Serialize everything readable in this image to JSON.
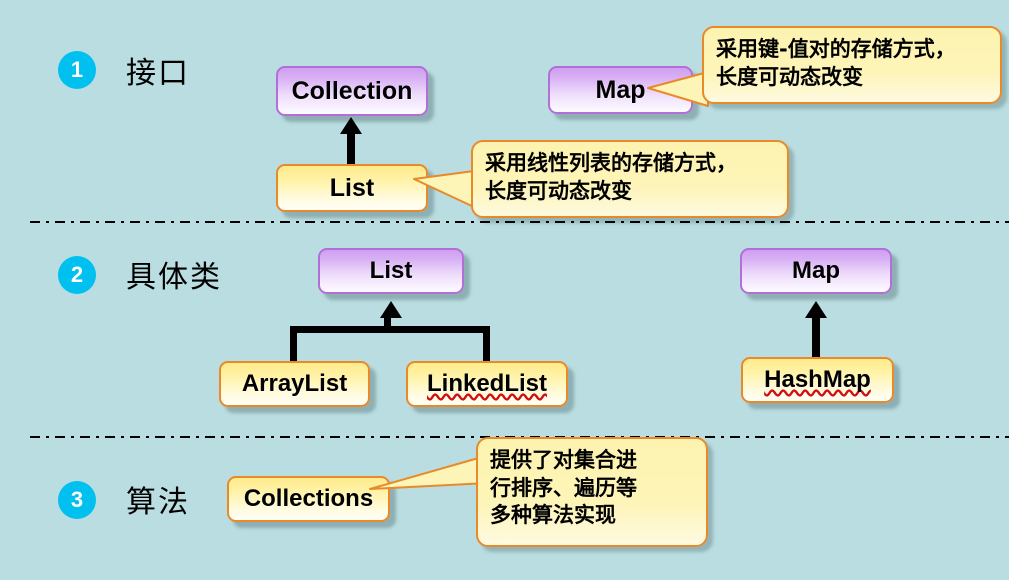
{
  "diagram": {
    "title_note": "Java collection framework hierarchy diagram",
    "background_color": "#b9dde0",
    "accent_badge_color": "#00c0f0",
    "interface_box_color": "#cf9ff0",
    "class_box_color": "#ffeb8d",
    "callout_border_color": "#e8892a"
  },
  "sections": [
    {
      "number": "1",
      "title": "接口"
    },
    {
      "number": "2",
      "title": "具体类"
    },
    {
      "number": "3",
      "title": "算法"
    }
  ],
  "nodes": {
    "collection": "Collection",
    "map_interface": "Map",
    "list_interface": "List",
    "list_class": "List",
    "map_class": "Map",
    "arraylist": "ArrayList",
    "linkedlist": "LinkedList",
    "hashmap": "HashMap",
    "collections": "Collections"
  },
  "callouts": {
    "map": {
      "lines": [
        "采用键-值对的存储方式，",
        "长度可动态改变"
      ]
    },
    "list": {
      "lines": [
        "采用线性列表的存储方式，",
        "长度可动态改变"
      ]
    },
    "collections": {
      "lines": [
        "提供了对集合进",
        "行排序、遍历等",
        "多种算法实现"
      ]
    }
  }
}
